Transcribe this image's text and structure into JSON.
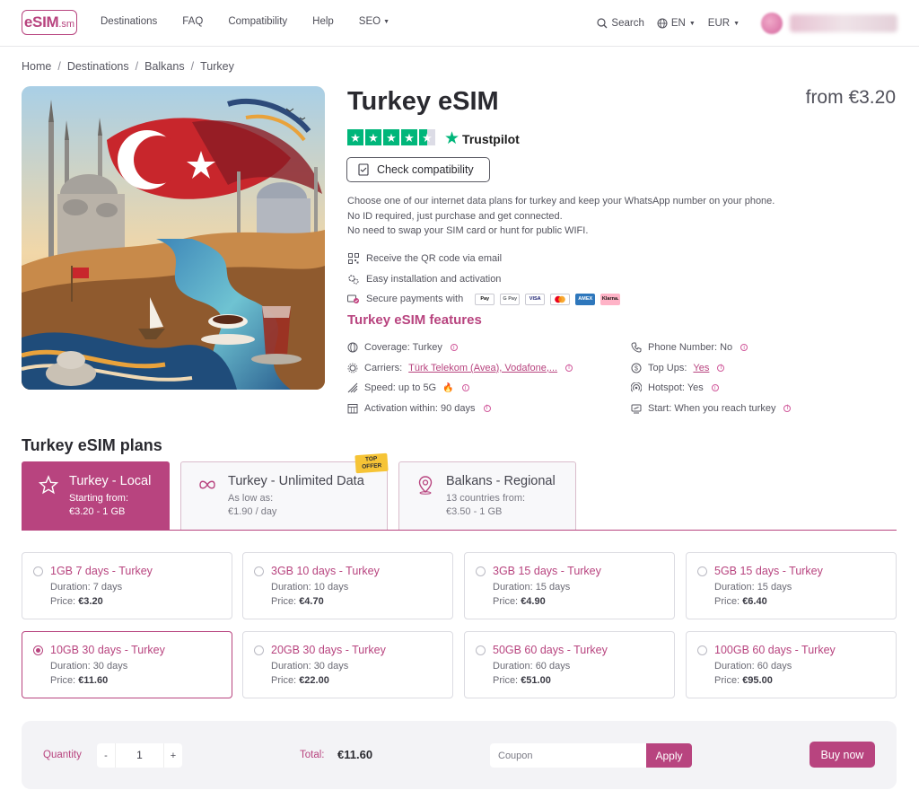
{
  "header": {
    "logo_main": "eSIM",
    "logo_suffix": ".sm",
    "nav": [
      "Destinations",
      "FAQ",
      "Compatibility",
      "Help",
      "SEO"
    ],
    "search_label": "Search",
    "language": "EN",
    "currency": "EUR"
  },
  "breadcrumb": [
    "Home",
    "Destinations",
    "Balkans",
    "Turkey"
  ],
  "product": {
    "title": "Turkey eSIM",
    "from_price": "from €3.20",
    "rating_stars": 4.5,
    "trustpilot": "Trustpilot",
    "check_button": "Check compatibility",
    "description": [
      "Choose one of our internet data plans for turkey and keep your WhatsApp number on your phone.",
      "No ID required, just purchase and get connected.",
      "No need to swap your SIM card or hunt for public WIFI."
    ],
    "perks": {
      "qr": "Receive the QR code via email",
      "install": "Easy installation and activation",
      "payments": "Secure payments with"
    },
    "payment_methods": [
      "Pay",
      "G Pay",
      "VISA",
      "mc",
      "AMEX",
      "Klarna."
    ],
    "features_title": "Turkey eSIM features",
    "features": {
      "coverage": "Coverage: Turkey",
      "carriers_label": "Carriers:",
      "carriers_value": "Türk Telekom (Avea), Vodafone,...",
      "speed": "Speed: up to 5G",
      "activation": "Activation within: 90 days",
      "phone": "Phone Number: No",
      "topups_label": "Top Ups:",
      "topups_value": "Yes",
      "hotspot": "Hotspot: Yes",
      "start": "Start: When you reach turkey"
    }
  },
  "plans": {
    "title": "Turkey eSIM plans",
    "top_offer": "TOP OFFER",
    "tabs": [
      {
        "name": "Turkey - Local",
        "sub1": "Starting from:",
        "sub2": "€3.20 - 1 GB"
      },
      {
        "name": "Turkey - Unlimited Data",
        "sub1": "As low as:",
        "sub2": "€1.90 / day"
      },
      {
        "name": "Balkans - Regional",
        "sub1": "13 countries from:",
        "sub2": "€3.50 - 1 GB"
      }
    ],
    "price_label": "Price:",
    "cards": [
      {
        "name": "1GB 7 days - Turkey",
        "duration": "Duration: 7 days",
        "price": "€3.20"
      },
      {
        "name": "3GB 10 days - Turkey",
        "duration": "Duration: 10 days",
        "price": "€4.70"
      },
      {
        "name": "3GB 15 days - Turkey",
        "duration": "Duration: 15 days",
        "price": "€4.90"
      },
      {
        "name": "5GB 15 days - Turkey",
        "duration": "Duration: 15 days",
        "price": "€6.40"
      },
      {
        "name": "10GB 30 days - Turkey",
        "duration": "Duration: 30 days",
        "price": "€11.60"
      },
      {
        "name": "20GB 30 days - Turkey",
        "duration": "Duration: 30 days",
        "price": "€22.00"
      },
      {
        "name": "50GB 60 days - Turkey",
        "duration": "Duration: 60 days",
        "price": "€51.00"
      },
      {
        "name": "100GB 60 days - Turkey",
        "duration": "Duration: 60 days",
        "price": "€95.00"
      }
    ]
  },
  "checkout": {
    "quantity_label": "Quantity",
    "minus": "-",
    "quantity": "1",
    "plus": "+",
    "total_label": "Total:",
    "total_value": "€11.60",
    "coupon_placeholder": "Coupon",
    "apply": "Apply",
    "buy": "Buy now"
  },
  "colors": {
    "brand": "#b8447f",
    "trustpilot_green": "#00b67a",
    "offer_badge": "#f6c436"
  }
}
